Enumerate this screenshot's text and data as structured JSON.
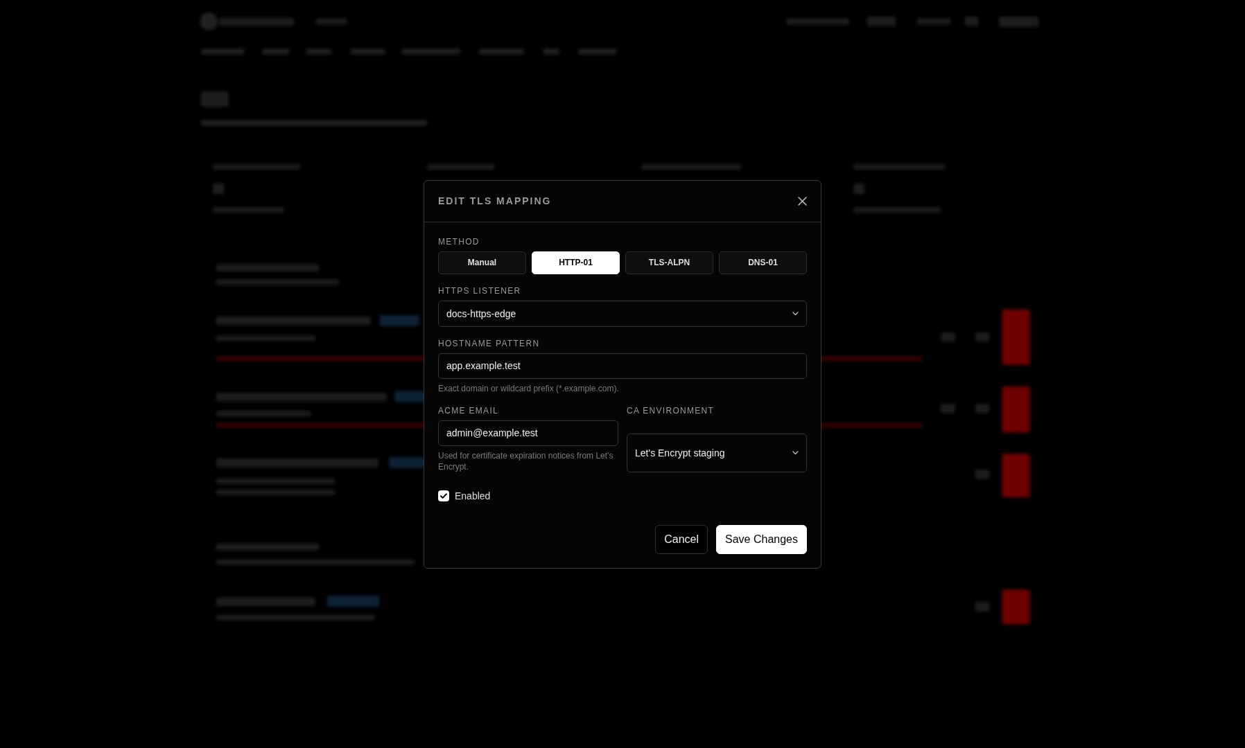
{
  "dialog": {
    "title": "EDIT TLS MAPPING",
    "method": {
      "label": "METHOD",
      "options": [
        {
          "label": "Manual",
          "selected": false
        },
        {
          "label": "HTTP-01",
          "selected": true
        },
        {
          "label": "TLS-ALPN",
          "selected": false
        },
        {
          "label": "DNS-01",
          "selected": false
        }
      ]
    },
    "https_listener": {
      "label": "HTTPS LISTENER",
      "value": "docs-https-edge"
    },
    "hostname_pattern": {
      "label": "HOSTNAME PATTERN",
      "value": "app.example.test",
      "hint": "Exact domain or wildcard prefix (*.example.com)."
    },
    "acme_email": {
      "label": "ACME EMAIL",
      "value": "admin@example.test",
      "hint": "Used for certificate expiration notices from Let's Encrypt."
    },
    "ca_environment": {
      "label": "CA ENVIRONMENT",
      "value": "Let's Encrypt staging"
    },
    "enabled": {
      "label": "Enabled",
      "checked": true
    },
    "buttons": [
      {
        "label": "Cancel",
        "kind": "secondary"
      },
      {
        "label": "Save Changes",
        "kind": "primary"
      }
    ]
  }
}
